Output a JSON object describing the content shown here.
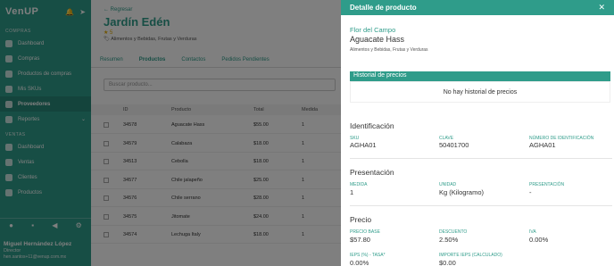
{
  "sidebar": {
    "logo": "VenUP",
    "icons": [
      "bell-icon",
      "send-icon"
    ],
    "section_compras": "Compras",
    "items_compras": [
      {
        "label": "Dashboard",
        "active": false
      },
      {
        "label": "Compras",
        "active": false
      },
      {
        "label": "Productos de compras",
        "active": false
      },
      {
        "label": "Mis SKUs",
        "active": false
      },
      {
        "label": "Proveedores",
        "active": true
      },
      {
        "label": "Reportes",
        "active": false,
        "chevron": "⌄"
      }
    ],
    "section_ventas": "Ventas",
    "items_ventas": [
      {
        "label": "Dashboard"
      },
      {
        "label": "Ventas"
      },
      {
        "label": "Clientes"
      },
      {
        "label": "Productos"
      }
    ],
    "user": {
      "name": "Miguel Hernández López",
      "role": "Director",
      "email": "hen.santos+11@venup.com.mx"
    }
  },
  "main": {
    "back": "← Regresar",
    "store_name": "Jardín Edén",
    "rating": "★ 5",
    "categories": "🏷 Alimentos y Bebidas, Frutas y Verduras",
    "tabs": [
      "Resumen",
      "Productos",
      "Contactos",
      "Pedidos Pendientes"
    ],
    "search_placeholder": "Buscar producto...",
    "columns": [
      "ID",
      "Producto",
      "Total",
      "Medida"
    ],
    "rows": [
      {
        "id": "34578",
        "product": "Aguacate Hass",
        "total": "$55.00",
        "medida": "1"
      },
      {
        "id": "34579",
        "product": "Calabaza",
        "total": "$18.00",
        "medida": "1"
      },
      {
        "id": "34513",
        "product": "Cebolla",
        "total": "$18.00",
        "medida": "1"
      },
      {
        "id": "34577",
        "product": "Chile jalapeño",
        "total": "$25.00",
        "medida": "1"
      },
      {
        "id": "34576",
        "product": "Chile serrano",
        "total": "$28.00",
        "medida": "1"
      },
      {
        "id": "34575",
        "product": "Jitomate",
        "total": "$24.00",
        "medida": "1"
      },
      {
        "id": "34574",
        "product": "Lechuga Italy",
        "total": "$18.00",
        "medida": "1"
      }
    ]
  },
  "drawer": {
    "title": "Detalle de producto",
    "close": "✕",
    "brand": "Flor del Campo",
    "product_name": "Aguacate Hass",
    "product_categories": "Alimentos y Bebidas, Frutas y Verduras",
    "history_title": "Historial de precios",
    "history_empty": "No hay historial de precios",
    "identificacion": {
      "title": "Identificación",
      "sku_label": "SKU",
      "sku": "AGHA01",
      "clave_label": "Clave",
      "clave": "50401700",
      "num_label": "Número de identificación",
      "num": "AGHA01"
    },
    "presentacion": {
      "title": "Presentación",
      "medida_label": "Medida",
      "medida": "1",
      "unidad_label": "Unidad",
      "unidad": "Kg (Kilogramo)",
      "presentacion_label": "Presentación",
      "presentacion": "-"
    },
    "precio": {
      "title": "Precio",
      "base_label": "Precio base",
      "base": "$57.80",
      "desc_label": "Descuento",
      "desc": "2.50%",
      "iva_label": "IVA",
      "iva": "0.00%",
      "ieps_label": "IEPS (%) - Tasa*",
      "ieps": "0.00%",
      "ieps_calc_label": "Importe IEPS (calculado)",
      "ieps_calc": "$0.00"
    }
  }
}
